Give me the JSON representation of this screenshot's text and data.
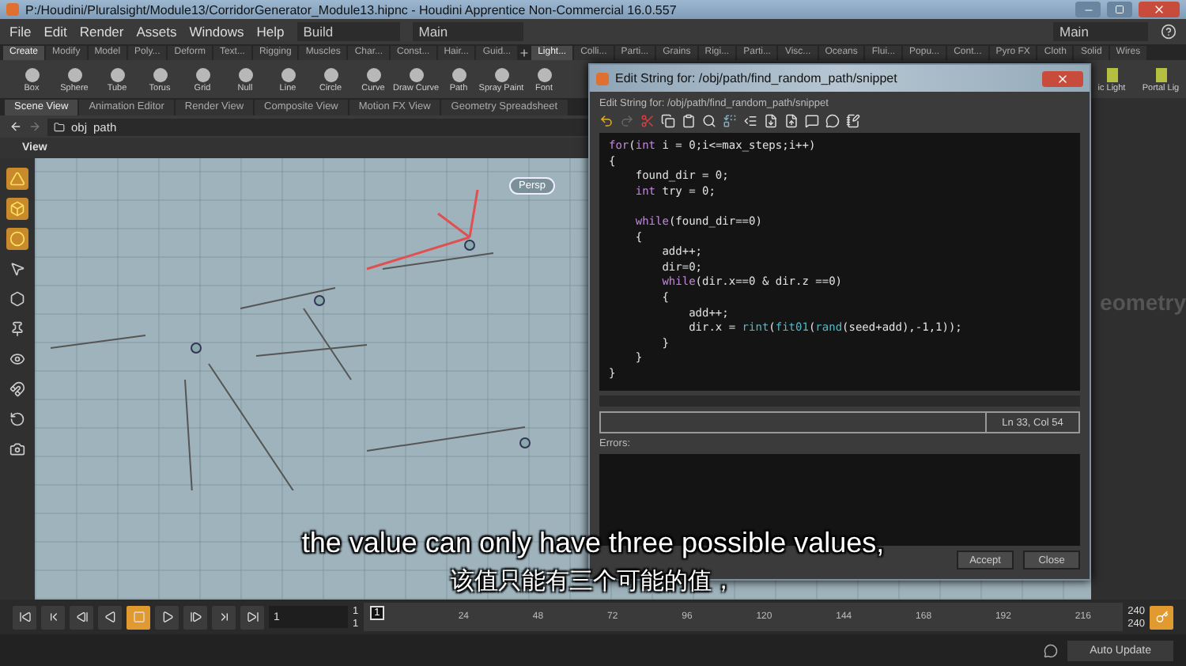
{
  "window": {
    "title": "P:/Houdini/Pluralsight/Module13/CorridorGenerator_Module13.hipnc - Houdini Apprentice Non-Commercial 16.0.557"
  },
  "menu": [
    "File",
    "Edit",
    "Render",
    "Assets",
    "Windows",
    "Help"
  ],
  "desktop": {
    "value": "Build"
  },
  "main_left": {
    "value": "Main"
  },
  "main_right": {
    "value": "Main"
  },
  "shelf_tabs": [
    {
      "label": "Create",
      "selected": true
    },
    {
      "label": "Modify",
      "selected": false
    },
    {
      "label": "Model",
      "selected": false
    },
    {
      "label": "Poly...",
      "selected": false
    },
    {
      "label": "Deform",
      "selected": false
    },
    {
      "label": "Text...",
      "selected": false
    },
    {
      "label": "Rigging",
      "selected": false
    },
    {
      "label": "Muscles",
      "selected": false
    },
    {
      "label": "Char...",
      "selected": false
    },
    {
      "label": "Const...",
      "selected": false
    },
    {
      "label": "Hair...",
      "selected": false
    },
    {
      "label": "Guid...",
      "selected": false
    }
  ],
  "shelf_tabs_right": [
    {
      "label": "Light...",
      "selected": true
    },
    {
      "label": "Colli...",
      "selected": false
    },
    {
      "label": "Parti...",
      "selected": false
    },
    {
      "label": "Grains",
      "selected": false
    },
    {
      "label": "Rigi...",
      "selected": false
    },
    {
      "label": "Parti...",
      "selected": false
    },
    {
      "label": "Visc...",
      "selected": false
    },
    {
      "label": "Oceans",
      "selected": false
    },
    {
      "label": "Flui...",
      "selected": false
    },
    {
      "label": "Popu...",
      "selected": false
    },
    {
      "label": "Cont...",
      "selected": false
    },
    {
      "label": "Pyro FX",
      "selected": false
    },
    {
      "label": "Cloth",
      "selected": false
    },
    {
      "label": "Solid",
      "selected": false
    },
    {
      "label": "Wires",
      "selected": false
    }
  ],
  "shelf_tools": [
    "Box",
    "Sphere",
    "Tube",
    "Torus",
    "Grid",
    "Null",
    "Line",
    "Circle",
    "Curve",
    "Draw Curve",
    "Path",
    "Spray Paint",
    "Font"
  ],
  "shelf_tools_right": [
    "ic Light",
    "Portal Lig"
  ],
  "pane_tabs": [
    {
      "label": "Scene View",
      "selected": true
    },
    {
      "label": "Animation Editor",
      "selected": false
    },
    {
      "label": "Render View",
      "selected": false
    },
    {
      "label": "Composite View",
      "selected": false
    },
    {
      "label": "Motion FX View",
      "selected": false
    },
    {
      "label": "Geometry Spreadsheet",
      "selected": false
    }
  ],
  "path": [
    "obj",
    "path"
  ],
  "viewport": {
    "title": "View",
    "camera": "Persp"
  },
  "side_panel": {
    "text": "eometry"
  },
  "dialog": {
    "title": "Edit String for: /obj/path/find_random_path/snippet",
    "label": "Edit String for: /obj/path/find_random_path/snippet",
    "code": [
      {
        "blank_before": false,
        "tokens": [
          {
            "kind": "keyword",
            "text": "for"
          },
          {
            "kind": "plain",
            "text": "("
          },
          {
            "kind": "keyword",
            "text": "int"
          },
          {
            "kind": "plain",
            "text": " i = 0;i<=max_steps;i++)"
          }
        ]
      },
      {
        "blank_before": false,
        "tokens": [
          {
            "kind": "plain",
            "text": "{"
          }
        ]
      },
      {
        "blank_before": false,
        "tokens": [
          {
            "kind": "plain",
            "text": "    found_dir = 0;"
          }
        ]
      },
      {
        "blank_before": false,
        "tokens": [
          {
            "kind": "keyword",
            "text": "    int"
          },
          {
            "kind": "plain",
            "text": " try = 0;"
          }
        ]
      },
      {
        "blank_before": true,
        "tokens": [
          {
            "kind": "keyword",
            "text": "    while"
          },
          {
            "kind": "plain",
            "text": "(found_dir==0)"
          }
        ]
      },
      {
        "blank_before": false,
        "tokens": [
          {
            "kind": "plain",
            "text": "    {"
          }
        ]
      },
      {
        "blank_before": false,
        "tokens": [
          {
            "kind": "plain",
            "text": "        add++;"
          }
        ]
      },
      {
        "blank_before": false,
        "tokens": [
          {
            "kind": "plain",
            "text": "        dir=0;"
          }
        ]
      },
      {
        "blank_before": false,
        "tokens": [
          {
            "kind": "keyword",
            "text": "        while"
          },
          {
            "kind": "plain",
            "text": "(dir.x==0 & dir.z ==0)"
          }
        ]
      },
      {
        "blank_before": false,
        "tokens": [
          {
            "kind": "plain",
            "text": "        {"
          }
        ]
      },
      {
        "blank_before": false,
        "tokens": [
          {
            "kind": "plain",
            "text": "            add++;"
          }
        ]
      },
      {
        "blank_before": false,
        "tokens": [
          {
            "kind": "plain",
            "text": "            dir.x = "
          },
          {
            "kind": "func",
            "text": "rint"
          },
          {
            "kind": "plain",
            "text": "("
          },
          {
            "kind": "func",
            "text": "fit01"
          },
          {
            "kind": "plain",
            "text": "("
          },
          {
            "kind": "func",
            "text": "rand"
          },
          {
            "kind": "plain",
            "text": "(seed+add),-1,1));"
          }
        ]
      },
      {
        "blank_before": false,
        "tokens": [
          {
            "kind": "plain",
            "text": "        }"
          }
        ]
      },
      {
        "blank_before": false,
        "tokens": [
          {
            "kind": "plain",
            "text": "    }"
          }
        ]
      },
      {
        "blank_before": false,
        "tokens": [
          {
            "kind": "plain",
            "text": "}"
          }
        ]
      }
    ],
    "cursor": "Ln 33, Col 54",
    "errors_label": "Errors:",
    "buttons": [
      "Accept",
      "Close"
    ]
  },
  "timeline": {
    "start": "1",
    "range_start": [
      "1",
      "1"
    ],
    "current": "1",
    "ticks": [
      "24",
      "48",
      "72",
      "96",
      "120",
      "144",
      "168",
      "192",
      "216"
    ],
    "range_end": [
      "240",
      "240"
    ],
    "controls": [
      {
        "kind": "first",
        "selected": false
      },
      {
        "kind": "prevkey",
        "selected": false
      },
      {
        "kind": "stepback",
        "selected": false
      },
      {
        "kind": "reverse",
        "selected": false
      },
      {
        "kind": "stop",
        "selected": true
      },
      {
        "kind": "play",
        "selected": false
      },
      {
        "kind": "stepforward",
        "selected": false
      },
      {
        "kind": "nextkey",
        "selected": false
      },
      {
        "kind": "last",
        "selected": false
      }
    ]
  },
  "status_bar": {
    "button": "Auto Update"
  },
  "subtitles": [
    "the value can only have three possible values,",
    "该值只能有三个可能的值，"
  ]
}
